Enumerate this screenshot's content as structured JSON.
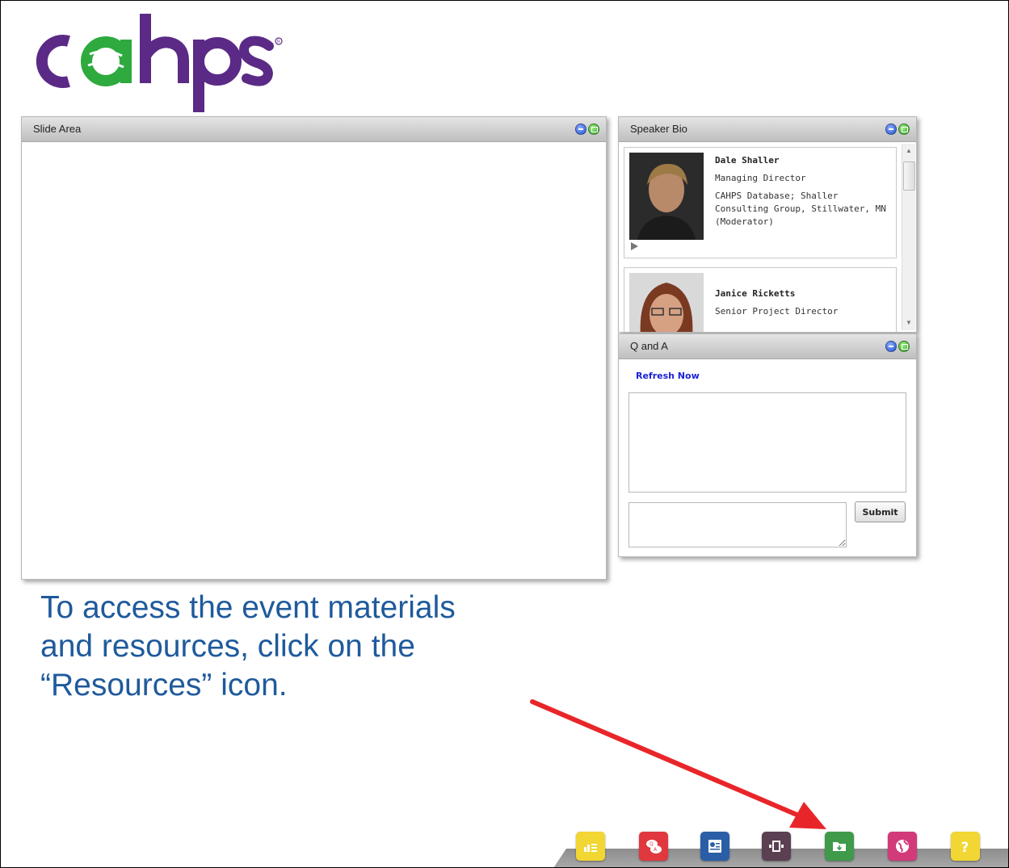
{
  "brand": {
    "logo_text": "cahps",
    "colors": {
      "purple": "#5b2a86",
      "green": "#2eaa3f"
    }
  },
  "slide_panel": {
    "title": "Slide Area"
  },
  "speaker_panel": {
    "title": "Speaker Bio",
    "speakers": [
      {
        "name": "Dale Shaller",
        "role": "Managing Director",
        "organization_lines": [
          "CAHPS Database; Shaller",
          "Consulting Group, Stillwater, MN",
          "(Moderator)"
        ]
      },
      {
        "name": "Janice Ricketts",
        "role": "Senior Project Director"
      }
    ]
  },
  "qa_panel": {
    "title": "Q and A",
    "refresh_label": "Refresh Now",
    "submit_label": "Submit"
  },
  "caption": {
    "lines": [
      "To access the event materials",
      "and resources, click on the",
      "“Resources” icon."
    ],
    "color": "#1f5a9c"
  },
  "dock": {
    "icons": [
      {
        "name": "slides-icon",
        "color": "#f2d633"
      },
      {
        "name": "qa-icon",
        "color": "#e0383e"
      },
      {
        "name": "speaker-bio-icon",
        "color": "#2a5ea6"
      },
      {
        "name": "media-player-icon",
        "color": "#5a4050"
      },
      {
        "name": "resources-icon",
        "color": "#3f9a4a"
      },
      {
        "name": "web-links-icon",
        "color": "#d23a7a"
      },
      {
        "name": "help-icon",
        "color": "#f2d633"
      }
    ]
  },
  "arrow_color": "#e8262a"
}
